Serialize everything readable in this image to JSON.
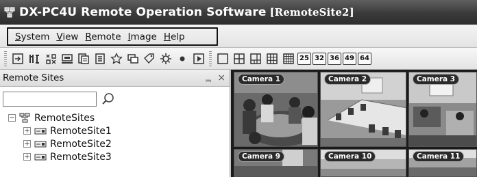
{
  "window": {
    "title": "DX-PC4U Remote Operation Software",
    "site": "[RemoteSite2]",
    "icon": "network-icon"
  },
  "menu": {
    "items": [
      {
        "name": "System",
        "mnemonic": "S",
        "rest": "ystem"
      },
      {
        "name": "View",
        "mnemonic": "V",
        "rest": "iew"
      },
      {
        "name": "Remote",
        "mnemonic": "R",
        "rest": "emote"
      },
      {
        "name": "Image",
        "mnemonic": "I",
        "rest": "mage"
      },
      {
        "name": "Help",
        "mnemonic": "H",
        "rest": "elp"
      }
    ]
  },
  "toolbar": {
    "layout_numbers": [
      "25",
      "32",
      "36",
      "49",
      "64"
    ]
  },
  "panel": {
    "title": "Remote Sites",
    "pin_glyph": "ᆿ",
    "close_glyph": "×",
    "search": {
      "value": "",
      "placeholder": ""
    },
    "tree": {
      "root": {
        "label": "RemoteSites",
        "expander": "−"
      },
      "children": [
        {
          "label": "RemoteSite1",
          "expander": "+"
        },
        {
          "label": "RemoteSite2",
          "expander": "+"
        },
        {
          "label": "RemoteSite3",
          "expander": "+"
        }
      ]
    }
  },
  "cameras": [
    {
      "label": "Camera 1"
    },
    {
      "label": "Camera 2"
    },
    {
      "label": "Camera 3"
    },
    {
      "label": "Camera 9"
    },
    {
      "label": "Camera 10"
    },
    {
      "label": "Camera 11"
    }
  ]
}
